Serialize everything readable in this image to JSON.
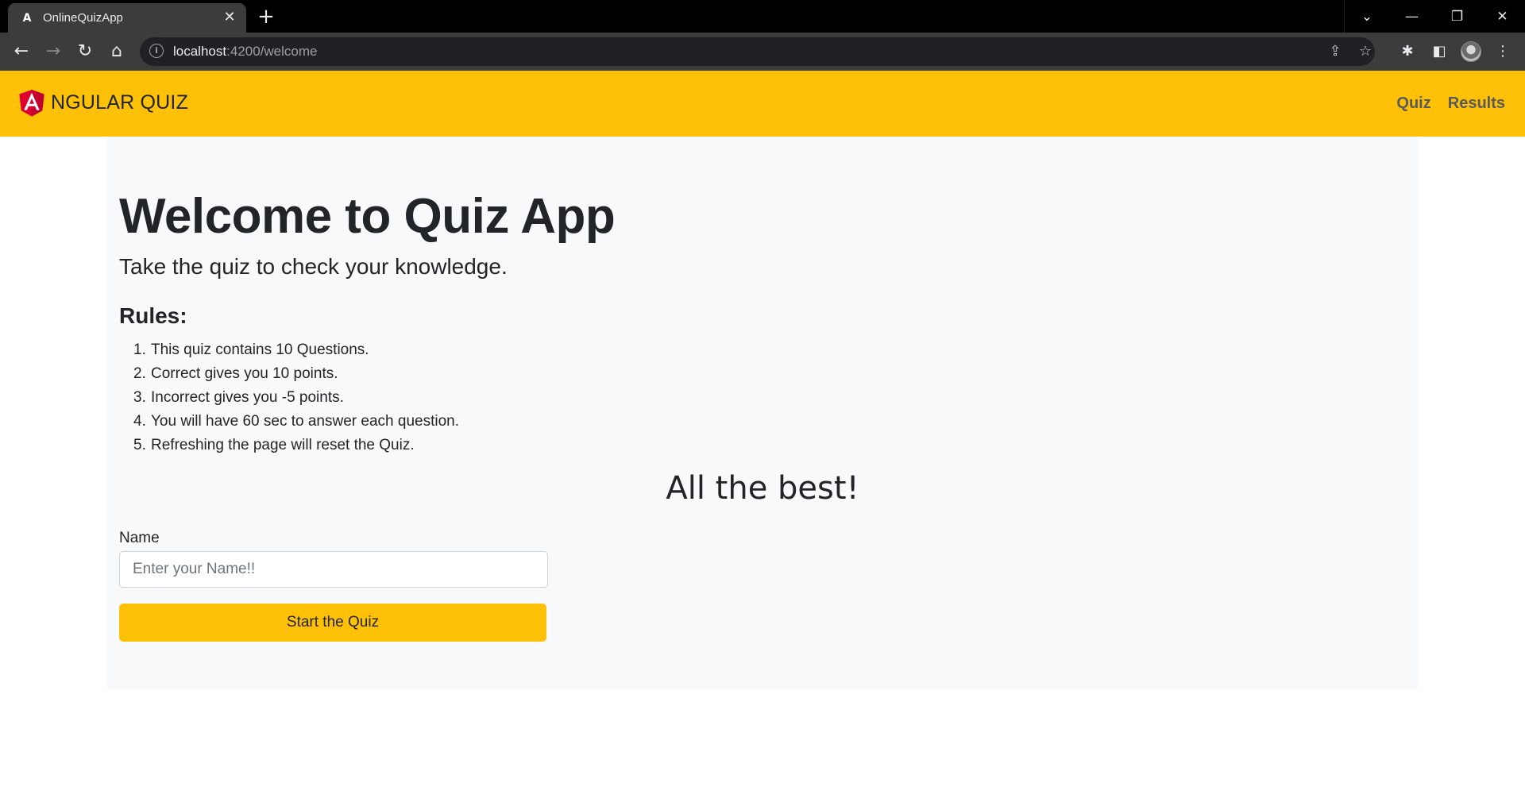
{
  "browser": {
    "tab_title": "OnlineQuizApp",
    "tab_favicon": "angular-icon",
    "url_host": "localhost",
    "url_path": ":4200/welcome"
  },
  "navbar": {
    "brand_text": "NGULAR QUIZ",
    "brand_logo": "angular-shield-logo",
    "links": [
      {
        "label": "Quiz"
      },
      {
        "label": "Results"
      }
    ],
    "color": "#ffc107"
  },
  "welcome": {
    "title": "Welcome to Quiz App",
    "lead": "Take the quiz to check your knowledge.",
    "rules_heading": "Rules:",
    "rules": [
      {
        "num": "1.",
        "text": "This quiz contains 10 Questions."
      },
      {
        "num": "2.",
        "text": "Correct gives you 10 points."
      },
      {
        "num": "3.",
        "text": "Incorrect gives you -5 points."
      },
      {
        "num": "4.",
        "text": "You will have 60 sec to answer each question."
      },
      {
        "num": "5.",
        "text": "Refreshing the page will reset the Quiz."
      }
    ],
    "best_wishes": "All the best!"
  },
  "form": {
    "name_label": "Name",
    "name_placeholder": "Enter your Name!!",
    "name_value": "",
    "start_label": "Start the Quiz"
  }
}
